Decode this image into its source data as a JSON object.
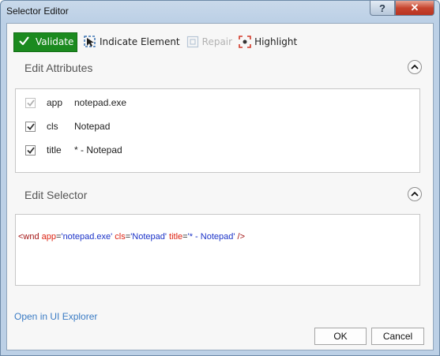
{
  "window": {
    "title": "Selector Editor",
    "help_label": "?",
    "close_label": "✕"
  },
  "toolbar": {
    "validate_label": "Validate",
    "indicate_label": "Indicate Element",
    "repair_label": "Repair",
    "highlight_label": "Highlight"
  },
  "attributes_section": {
    "title": "Edit Attributes",
    "items": [
      {
        "checked": true,
        "enabled": false,
        "name": "app",
        "value": "notepad.exe"
      },
      {
        "checked": true,
        "enabled": true,
        "name": "cls",
        "value": "Notepad"
      },
      {
        "checked": true,
        "enabled": true,
        "name": "title",
        "value": "* - Notepad"
      }
    ]
  },
  "selector_section": {
    "title": "Edit Selector",
    "parts": {
      "open": "<wnd ",
      "a1": "app",
      "v1": "'notepad.exe'",
      "a2": "cls",
      "v2": "'Notepad'",
      "a3": "title",
      "v3": "'* - Notepad'",
      "close": " />"
    }
  },
  "footer": {
    "open_link": "Open in UI Explorer",
    "ok_label": "OK",
    "cancel_label": "Cancel"
  },
  "colors": {
    "validate_bg": "#1b8a1f",
    "link": "#3a7bc4",
    "close_button": "#c7452f"
  }
}
